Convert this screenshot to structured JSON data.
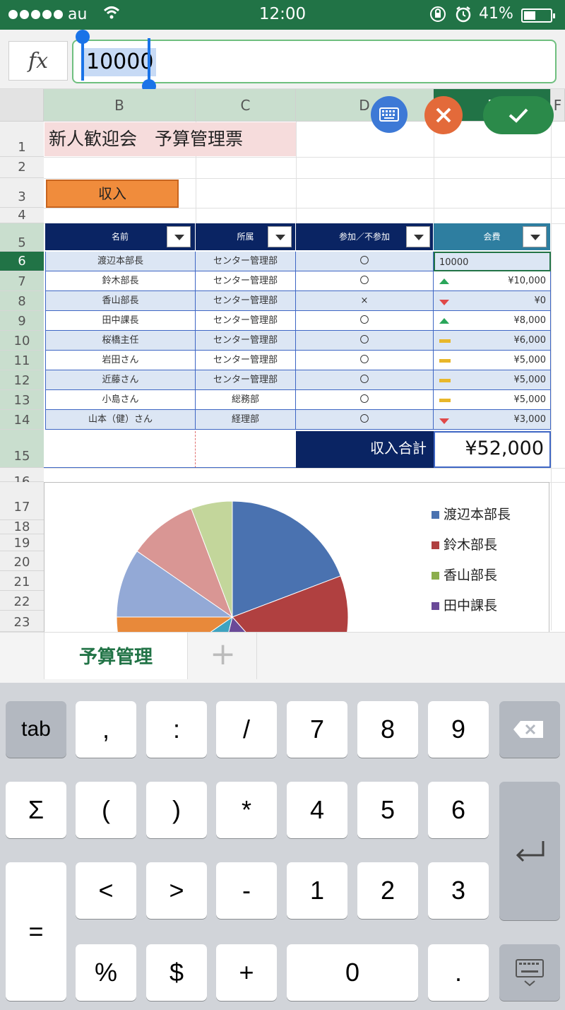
{
  "status_bar": {
    "carrier": "au",
    "time": "12:00",
    "battery": "41%"
  },
  "formula_bar": {
    "fx_label": "fx",
    "value": "10000"
  },
  "column_headers": [
    "B",
    "C",
    "D",
    "E",
    "F"
  ],
  "row_headers": [
    "1",
    "2",
    "3",
    "4",
    "5",
    "6",
    "7",
    "8",
    "9",
    "10",
    "11",
    "12",
    "13",
    "14",
    "15",
    "16",
    "17",
    "18",
    "19",
    "20",
    "21",
    "22",
    "23"
  ],
  "sheet": {
    "title": "新人歓迎会　予算管理票",
    "income_label": "収入",
    "table_headers": [
      "名前",
      "所属",
      "参加／不参加",
      "会費"
    ],
    "rows": [
      {
        "name": "渡辺本部長",
        "dept": "センター管理部",
        "attend": "〇",
        "fee": "10000",
        "trend": "none"
      },
      {
        "name": "鈴木部長",
        "dept": "センター管理部",
        "attend": "〇",
        "fee": "¥10,000",
        "trend": "up"
      },
      {
        "name": "香山部長",
        "dept": "センター管理部",
        "attend": "×",
        "fee": "¥0",
        "trend": "down"
      },
      {
        "name": "田中課長",
        "dept": "センター管理部",
        "attend": "〇",
        "fee": "¥8,000",
        "trend": "up"
      },
      {
        "name": "桜橋主任",
        "dept": "センター管理部",
        "attend": "〇",
        "fee": "¥6,000",
        "trend": "flat"
      },
      {
        "name": "岩田さん",
        "dept": "センター管理部",
        "attend": "〇",
        "fee": "¥5,000",
        "trend": "flat"
      },
      {
        "name": "近藤さん",
        "dept": "センター管理部",
        "attend": "〇",
        "fee": "¥5,000",
        "trend": "flat"
      },
      {
        "name": "小島さん",
        "dept": "総務部",
        "attend": "〇",
        "fee": "¥5,000",
        "trend": "flat"
      },
      {
        "name": "山本（健）さん",
        "dept": "経理部",
        "attend": "〇",
        "fee": "¥3,000",
        "trend": "down"
      }
    ],
    "total_label": "収入合計",
    "total_value": "¥52,000"
  },
  "chart_data": {
    "type": "pie",
    "categories": [
      "渡辺本部長",
      "鈴木部長",
      "香山部長",
      "田中課長",
      "桜橋主任",
      "岩田さん",
      "近藤さん",
      "小島さん",
      "山本（健）さん"
    ],
    "values": [
      10000,
      10000,
      0,
      8000,
      6000,
      5000,
      5000,
      5000,
      3000
    ],
    "colors": [
      "#4a72b0",
      "#b04040",
      "#8cae4c",
      "#6a4a98",
      "#3fa3c0",
      "#e8893a",
      "#93a9d6",
      "#d99694",
      "#c3d69b"
    ],
    "legend_visible": [
      "渡辺本部長",
      "鈴木部長",
      "香山部長",
      "田中課長"
    ],
    "legend_position": "right"
  },
  "sheet_tabs": {
    "active": "予算管理",
    "add": "+"
  },
  "keyboard": {
    "tab": "tab",
    "comma": ",",
    "colon": ":",
    "slash": "/",
    "k7": "7",
    "k8": "8",
    "k9": "9",
    "sigma": "Σ",
    "lparen": "(",
    "rparen": ")",
    "star": "*",
    "k4": "4",
    "k5": "5",
    "k6": "6",
    "equals": "=",
    "lt": "<",
    "gt": ">",
    "minus": "-",
    "k1": "1",
    "k2": "2",
    "k3": "3",
    "percent": "%",
    "dollar": "$",
    "plus": "+",
    "k0": "0",
    "dot": "."
  }
}
